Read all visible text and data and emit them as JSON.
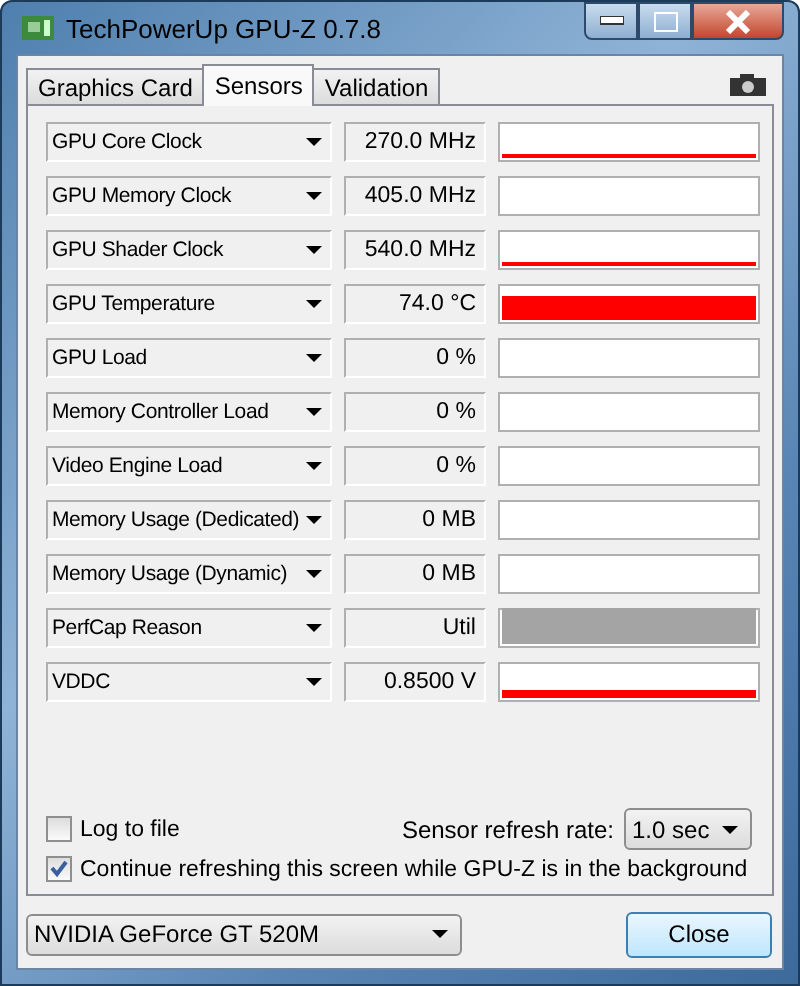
{
  "window": {
    "title": "TechPowerUp GPU-Z 0.7.8"
  },
  "tabs": [
    {
      "label": "Graphics Card",
      "selected": false
    },
    {
      "label": "Sensors",
      "selected": true
    },
    {
      "label": "Validation",
      "selected": false
    }
  ],
  "sensors": [
    {
      "name": "GPU Core Clock",
      "reading": "270.0 MHz",
      "kind": "low"
    },
    {
      "name": "GPU Memory Clock",
      "reading": "405.0 MHz",
      "kind": "empty"
    },
    {
      "name": "GPU Shader Clock",
      "reading": "540.0 MHz",
      "kind": "low"
    },
    {
      "name": "GPU Temperature",
      "reading": "74.0 °C",
      "kind": "high"
    },
    {
      "name": "GPU Load",
      "reading": "0 %",
      "kind": "empty"
    },
    {
      "name": "Memory Controller Load",
      "reading": "0 %",
      "kind": "empty"
    },
    {
      "name": "Video Engine Load",
      "reading": "0 %",
      "kind": "empty"
    },
    {
      "name": "Memory Usage (Dedicated)",
      "reading": "0 MB",
      "kind": "empty"
    },
    {
      "name": "Memory Usage (Dynamic)",
      "reading": "0 MB",
      "kind": "empty"
    },
    {
      "name": "PerfCap Reason",
      "reading": "Util",
      "kind": "idle"
    },
    {
      "name": "VDDC",
      "reading": "0.8500 V",
      "kind": "mid"
    }
  ],
  "log_to_file": {
    "label": "Log to file",
    "checked": false
  },
  "refresh_rate": {
    "label": "Sensor refresh rate:",
    "value": "1.0 sec"
  },
  "continue_refreshing": {
    "label": "Continue refreshing this screen while GPU-Z is in the background",
    "checked": true
  },
  "gpu_select": {
    "value": "NVIDIA GeForce GT 520M"
  },
  "close_button": "Close"
}
